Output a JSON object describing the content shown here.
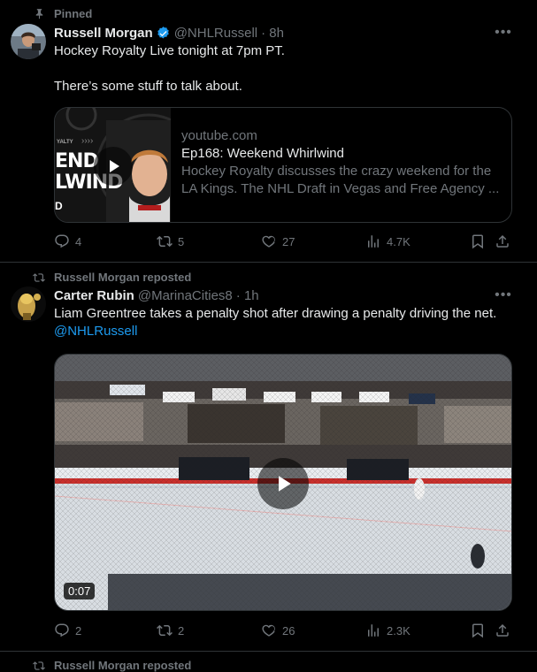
{
  "tweet1": {
    "pinned_label": "Pinned",
    "author_name": "Russell Morgan",
    "author_handle": "@NHLRussell",
    "timestamp": "· 8h",
    "text_line1": "Hockey Royalty Live tonight at 7pm PT.",
    "text_line2": "There’s some stuff to talk about.",
    "card": {
      "domain": "youtube.com",
      "title": "Ep168: Weekend Whirlwind",
      "description": "Hockey Royalty discusses the crazy weekend for the LA Kings. The NHL Draft in Vegas and Free Agency ...",
      "thumb_text_a": "END",
      "thumb_text_b": "LWIND",
      "thumb_text_small": "YALTY"
    },
    "replies": "4",
    "reposts": "5",
    "likes": "27",
    "views": "4.7K"
  },
  "tweet2": {
    "context_label": "Russell Morgan reposted",
    "author_name": "Carter Rubin",
    "author_handle": "@MarinaCities8",
    "timestamp": "· 1h",
    "text": "Liam Greentree takes a penalty shot after drawing a penalty driving the net.",
    "mention": "@NHLRussell",
    "video_duration": "0:07",
    "replies": "2",
    "reposts": "2",
    "likes": "26",
    "views": "2.3K"
  },
  "tweet3": {
    "context_label": "Russell Morgan reposted"
  },
  "colors": {
    "background": "#000000",
    "text_primary": "#e7e9ea",
    "text_secondary": "#71767b",
    "accent": "#1d9bf0",
    "border": "#2f3336"
  }
}
